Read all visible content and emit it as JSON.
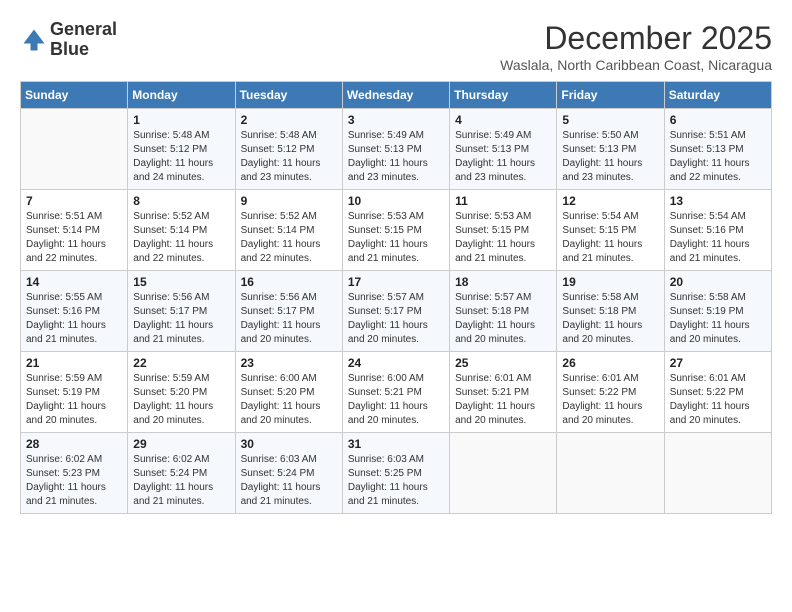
{
  "logo": {
    "general": "General",
    "blue": "Blue"
  },
  "title": "December 2025",
  "subtitle": "Waslala, North Caribbean Coast, Nicaragua",
  "days_header": [
    "Sunday",
    "Monday",
    "Tuesday",
    "Wednesday",
    "Thursday",
    "Friday",
    "Saturday"
  ],
  "weeks": [
    [
      {
        "day": "",
        "info": ""
      },
      {
        "day": "1",
        "info": "Sunrise: 5:48 AM\nSunset: 5:12 PM\nDaylight: 11 hours\nand 24 minutes."
      },
      {
        "day": "2",
        "info": "Sunrise: 5:48 AM\nSunset: 5:12 PM\nDaylight: 11 hours\nand 23 minutes."
      },
      {
        "day": "3",
        "info": "Sunrise: 5:49 AM\nSunset: 5:13 PM\nDaylight: 11 hours\nand 23 minutes."
      },
      {
        "day": "4",
        "info": "Sunrise: 5:49 AM\nSunset: 5:13 PM\nDaylight: 11 hours\nand 23 minutes."
      },
      {
        "day": "5",
        "info": "Sunrise: 5:50 AM\nSunset: 5:13 PM\nDaylight: 11 hours\nand 23 minutes."
      },
      {
        "day": "6",
        "info": "Sunrise: 5:51 AM\nSunset: 5:13 PM\nDaylight: 11 hours\nand 22 minutes."
      }
    ],
    [
      {
        "day": "7",
        "info": "Sunrise: 5:51 AM\nSunset: 5:14 PM\nDaylight: 11 hours\nand 22 minutes."
      },
      {
        "day": "8",
        "info": "Sunrise: 5:52 AM\nSunset: 5:14 PM\nDaylight: 11 hours\nand 22 minutes."
      },
      {
        "day": "9",
        "info": "Sunrise: 5:52 AM\nSunset: 5:14 PM\nDaylight: 11 hours\nand 22 minutes."
      },
      {
        "day": "10",
        "info": "Sunrise: 5:53 AM\nSunset: 5:15 PM\nDaylight: 11 hours\nand 21 minutes."
      },
      {
        "day": "11",
        "info": "Sunrise: 5:53 AM\nSunset: 5:15 PM\nDaylight: 11 hours\nand 21 minutes."
      },
      {
        "day": "12",
        "info": "Sunrise: 5:54 AM\nSunset: 5:15 PM\nDaylight: 11 hours\nand 21 minutes."
      },
      {
        "day": "13",
        "info": "Sunrise: 5:54 AM\nSunset: 5:16 PM\nDaylight: 11 hours\nand 21 minutes."
      }
    ],
    [
      {
        "day": "14",
        "info": "Sunrise: 5:55 AM\nSunset: 5:16 PM\nDaylight: 11 hours\nand 21 minutes."
      },
      {
        "day": "15",
        "info": "Sunrise: 5:56 AM\nSunset: 5:17 PM\nDaylight: 11 hours\nand 21 minutes."
      },
      {
        "day": "16",
        "info": "Sunrise: 5:56 AM\nSunset: 5:17 PM\nDaylight: 11 hours\nand 20 minutes."
      },
      {
        "day": "17",
        "info": "Sunrise: 5:57 AM\nSunset: 5:17 PM\nDaylight: 11 hours\nand 20 minutes."
      },
      {
        "day": "18",
        "info": "Sunrise: 5:57 AM\nSunset: 5:18 PM\nDaylight: 11 hours\nand 20 minutes."
      },
      {
        "day": "19",
        "info": "Sunrise: 5:58 AM\nSunset: 5:18 PM\nDaylight: 11 hours\nand 20 minutes."
      },
      {
        "day": "20",
        "info": "Sunrise: 5:58 AM\nSunset: 5:19 PM\nDaylight: 11 hours\nand 20 minutes."
      }
    ],
    [
      {
        "day": "21",
        "info": "Sunrise: 5:59 AM\nSunset: 5:19 PM\nDaylight: 11 hours\nand 20 minutes."
      },
      {
        "day": "22",
        "info": "Sunrise: 5:59 AM\nSunset: 5:20 PM\nDaylight: 11 hours\nand 20 minutes."
      },
      {
        "day": "23",
        "info": "Sunrise: 6:00 AM\nSunset: 5:20 PM\nDaylight: 11 hours\nand 20 minutes."
      },
      {
        "day": "24",
        "info": "Sunrise: 6:00 AM\nSunset: 5:21 PM\nDaylight: 11 hours\nand 20 minutes."
      },
      {
        "day": "25",
        "info": "Sunrise: 6:01 AM\nSunset: 5:21 PM\nDaylight: 11 hours\nand 20 minutes."
      },
      {
        "day": "26",
        "info": "Sunrise: 6:01 AM\nSunset: 5:22 PM\nDaylight: 11 hours\nand 20 minutes."
      },
      {
        "day": "27",
        "info": "Sunrise: 6:01 AM\nSunset: 5:22 PM\nDaylight: 11 hours\nand 20 minutes."
      }
    ],
    [
      {
        "day": "28",
        "info": "Sunrise: 6:02 AM\nSunset: 5:23 PM\nDaylight: 11 hours\nand 21 minutes."
      },
      {
        "day": "29",
        "info": "Sunrise: 6:02 AM\nSunset: 5:24 PM\nDaylight: 11 hours\nand 21 minutes."
      },
      {
        "day": "30",
        "info": "Sunrise: 6:03 AM\nSunset: 5:24 PM\nDaylight: 11 hours\nand 21 minutes."
      },
      {
        "day": "31",
        "info": "Sunrise: 6:03 AM\nSunset: 5:25 PM\nDaylight: 11 hours\nand 21 minutes."
      },
      {
        "day": "",
        "info": ""
      },
      {
        "day": "",
        "info": ""
      },
      {
        "day": "",
        "info": ""
      }
    ]
  ]
}
